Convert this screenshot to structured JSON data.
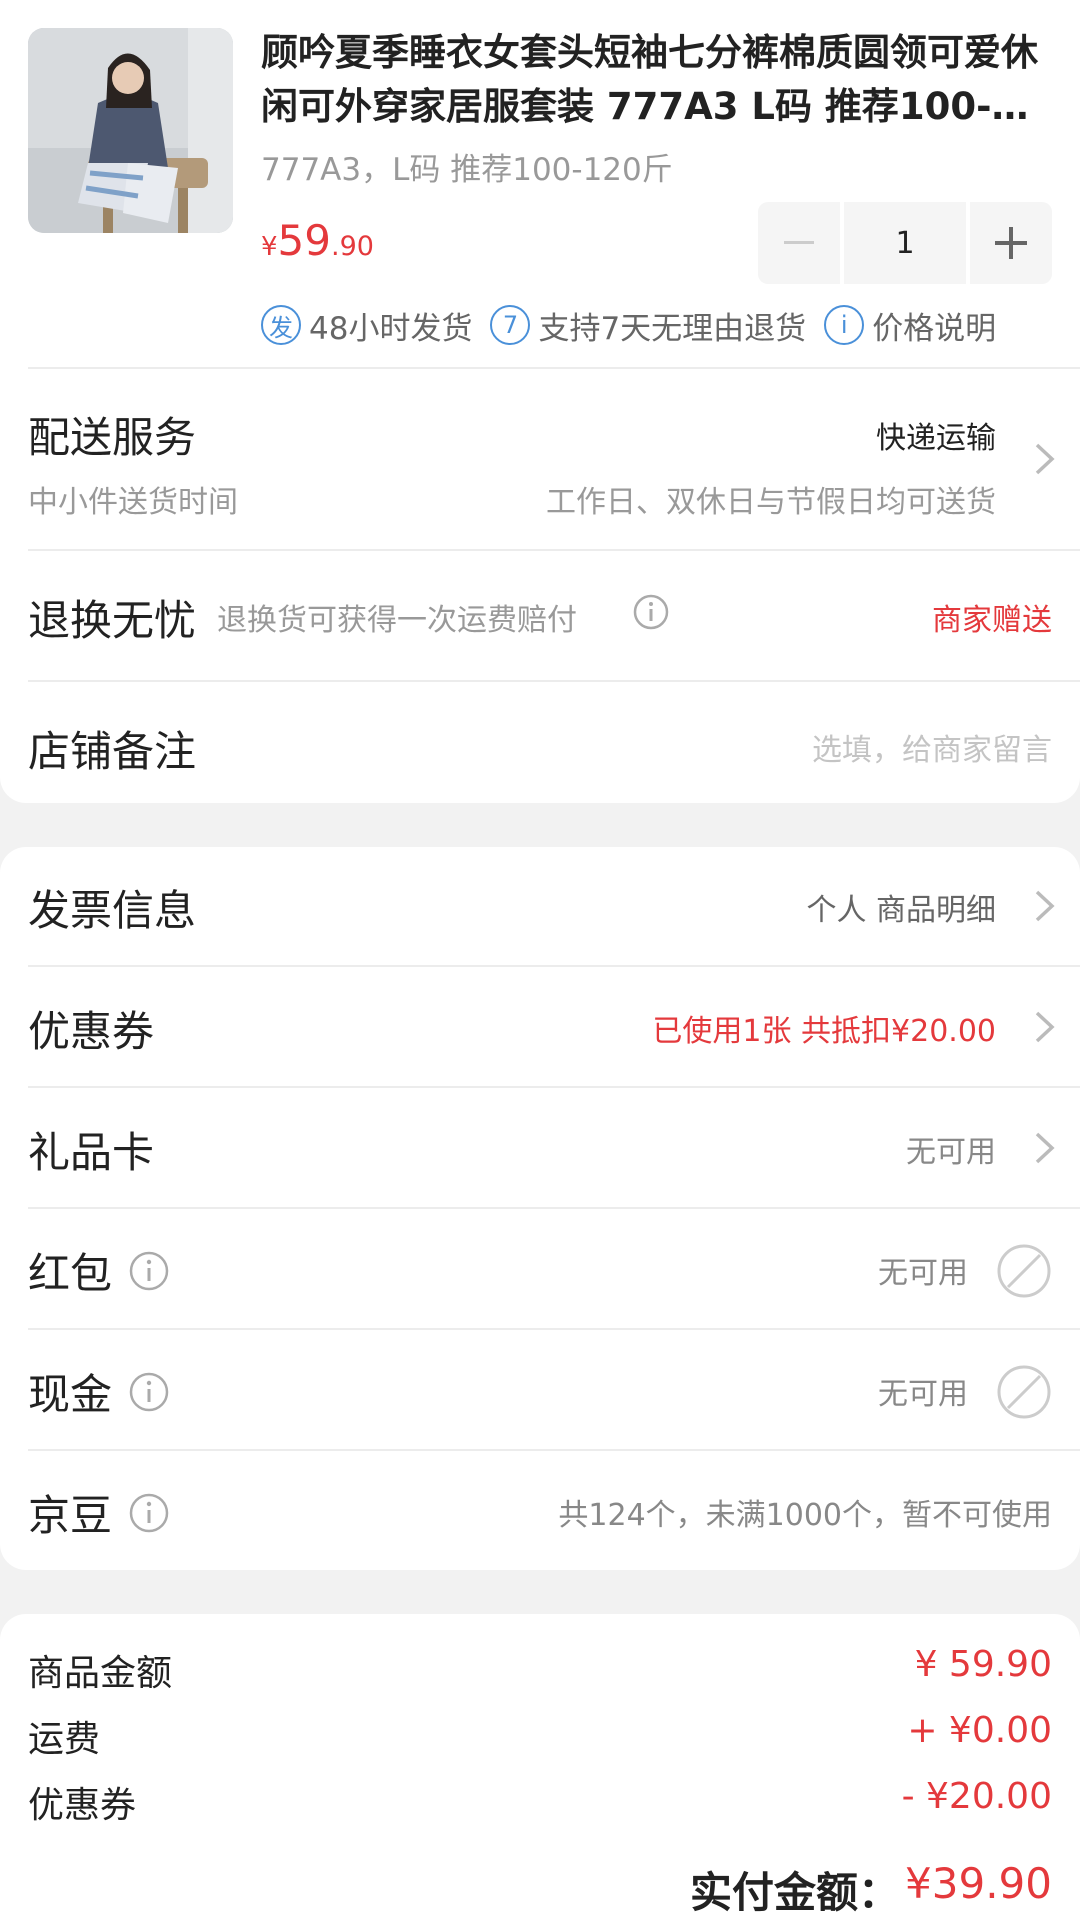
{
  "product": {
    "title": "顾吟夏季睡衣女套头短袖七分裤棉质圆领可爱休闲可外穿家居服套装 777A3 L码 推荐100-120斤",
    "spec": "777A3，L码 推荐100-120斤",
    "price_symbol": "¥",
    "price_int": "59",
    "price_dec": ".90",
    "quantity": "1",
    "services": [
      {
        "badge": "发",
        "label": "48小时发货",
        "icon": "ship-badge-icon"
      },
      {
        "badge": "7",
        "label": "支持7天无理由退货",
        "icon": "seven-day-return-icon"
      },
      {
        "badge": "i",
        "label": "价格说明",
        "icon": "info-icon"
      }
    ]
  },
  "delivery": {
    "label": "配送服务",
    "value": "快递运输",
    "sub_label": "中小件送货时间",
    "sub_value": "工作日、双休日与节假日均可送货"
  },
  "return_worry_free": {
    "label": "退换无忧",
    "desc": "退换货可获得一次运费赔付",
    "value": "商家赠送"
  },
  "remark": {
    "label": "店铺备注",
    "placeholder": "选填，给商家留言"
  },
  "invoice": {
    "label": "发票信息",
    "value": "个人 商品明细"
  },
  "coupon": {
    "label": "优惠券",
    "value": "已使用1张 共抵扣¥20.00"
  },
  "gift_card": {
    "label": "礼品卡",
    "value": "无可用"
  },
  "red_packet": {
    "label": "红包",
    "value": "无可用"
  },
  "cash": {
    "label": "现金",
    "value": "无可用"
  },
  "jd_beans": {
    "label": "京豆",
    "value": "共124个，未满1000个，暂不可使用"
  },
  "summary": {
    "goods_label": "商品金额",
    "goods_value": "¥ 59.90",
    "shipping_label": "运费",
    "shipping_value": "+ ¥0.00",
    "coupon_label": "优惠券",
    "coupon_value": "- ¥20.00",
    "total_label": "实付金额：",
    "total_value": "¥39.90"
  },
  "colors": {
    "accent": "#e4393c",
    "badge": "#4a90d9",
    "muted": "#999999"
  }
}
